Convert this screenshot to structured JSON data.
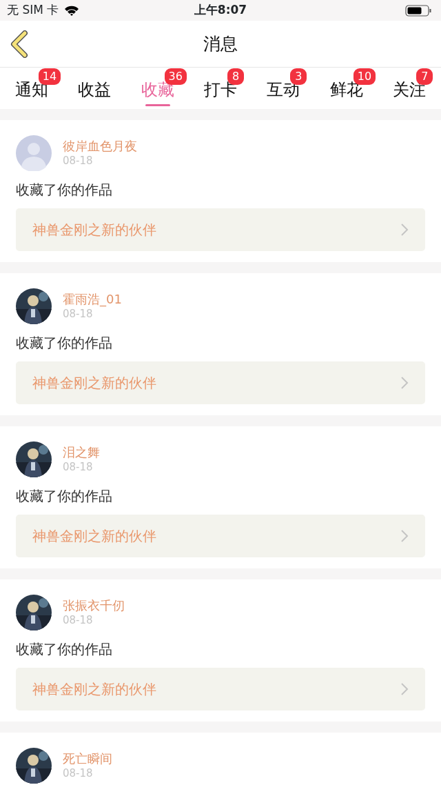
{
  "status_bar": {
    "carrier": "无 SIM 卡",
    "time": "上午8:07"
  },
  "header": {
    "title": "消息"
  },
  "tabs": [
    {
      "label": "通知",
      "badge": "14",
      "selected": false
    },
    {
      "label": "收益",
      "selected": false
    },
    {
      "label": "收藏",
      "badge": "36",
      "selected": true
    },
    {
      "label": "打卡",
      "badge": "8",
      "selected": false
    },
    {
      "label": "互动",
      "badge": "3",
      "selected": false
    },
    {
      "label": "鲜花",
      "badge": "10",
      "selected": false
    },
    {
      "label": "关注",
      "badge": "7",
      "selected": false
    }
  ],
  "messages": [
    {
      "kind": "default",
      "name": "彼岸血色月夜",
      "date": "08-18",
      "text": "收藏了你的作品",
      "work": "神兽金刚之新的伙伴"
    },
    {
      "kind": "picture",
      "name": "霍雨浩_01",
      "date": "08-18",
      "text": "收藏了你的作品",
      "work": "神兽金刚之新的伙伴"
    },
    {
      "kind": "picture",
      "name": "泪之舞",
      "date": "08-18",
      "text": "收藏了你的作品",
      "work": "神兽金刚之新的伙伴"
    },
    {
      "kind": "picture",
      "name": "张振衣千仞",
      "date": "08-18",
      "text": "收藏了你的作品",
      "work": "神兽金刚之新的伙伴"
    },
    {
      "kind": "picture",
      "name": "死亡瞬间",
      "date": "08-18"
    }
  ]
}
